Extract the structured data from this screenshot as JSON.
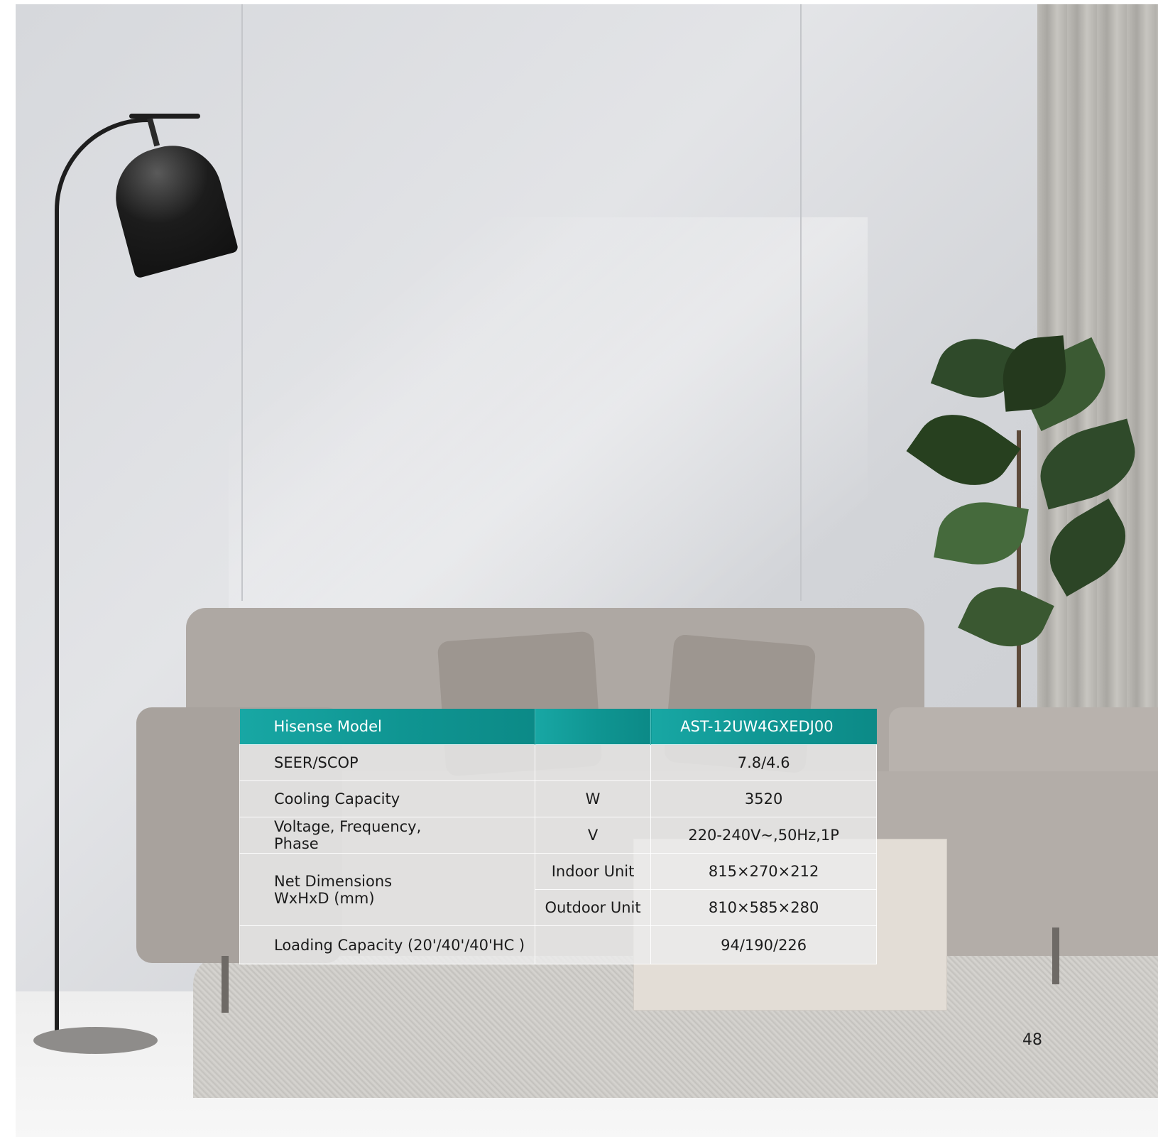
{
  "spec_table": {
    "header": {
      "label": "Hisense Model",
      "unit": "",
      "value": "AST-12UW4GXEDJ00"
    },
    "rows": [
      {
        "label": "SEER/SCOP",
        "unit": "",
        "value": "7.8/4.6"
      },
      {
        "label": "Cooling Capacity",
        "unit": "W",
        "value": "3520"
      },
      {
        "label_lines": [
          "Voltage, Frequency,",
          "Phase"
        ],
        "unit": "V",
        "value": "220-240V~,50Hz,1P"
      }
    ],
    "dimensions": {
      "label_lines": [
        "Net Dimensions",
        "WxHxD (mm)"
      ],
      "indoor": {
        "unit": "Indoor Unit",
        "value": "815×270×212"
      },
      "outdoor": {
        "unit": "Outdoor Unit",
        "value": "810×585×280"
      }
    },
    "loading": {
      "label": "Loading Capacity (20'/40'/40'HC )",
      "unit": "",
      "value": "94/190/226"
    }
  },
  "page_number": "48",
  "colors": {
    "header_teal": "#0f9592",
    "row_bg": "#ececec",
    "text": "#1b1b1b"
  }
}
